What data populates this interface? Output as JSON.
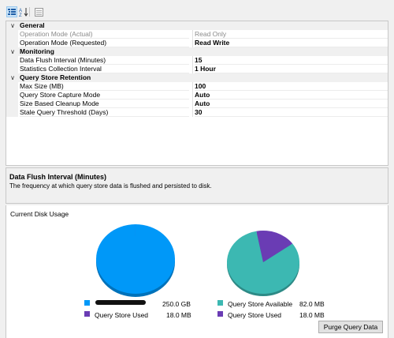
{
  "toolbar": {
    "categorized": "categorized-view-icon",
    "alphabetical": "alphabetical-sort-icon",
    "property_pages": "property-pages-icon"
  },
  "properties": {
    "general": {
      "title": "General",
      "operation_mode_actual": {
        "label": "Operation Mode (Actual)",
        "value": "Read Only"
      },
      "operation_mode_requested": {
        "label": "Operation Mode (Requested)",
        "value": "Read Write"
      }
    },
    "monitoring": {
      "title": "Monitoring",
      "data_flush_interval": {
        "label": "Data Flush Interval (Minutes)",
        "value": "15"
      },
      "statistics_collection_interval": {
        "label": "Statistics Collection Interval",
        "value": "1 Hour"
      }
    },
    "retention": {
      "title": "Query Store Retention",
      "max_size": {
        "label": "Max Size (MB)",
        "value": "100"
      },
      "capture_mode": {
        "label": "Query Store Capture Mode",
        "value": "Auto"
      },
      "cleanup_mode": {
        "label": "Size Based Cleanup Mode",
        "value": "Auto"
      },
      "stale_threshold": {
        "label": "Stale Query Threshold (Days)",
        "value": "30"
      }
    }
  },
  "description": {
    "title": "Data Flush Interval (Minutes)",
    "text": "The frequency at which query store data is flushed and persisted to disk."
  },
  "disk": {
    "title": "Current Disk Usage",
    "purge_label": "Purge Query Data",
    "colors": {
      "database": "#0098f8",
      "query_store_used": "#6a3cb4",
      "query_store_available": "#3cb8b2"
    }
  },
  "chart_data": [
    {
      "type": "pie",
      "slices": [
        {
          "name": "",
          "value": 250.0,
          "label": "250.0 GB",
          "color": "#0098f8"
        },
        {
          "name": "Query Store Used",
          "value": 0.018,
          "label": "18.0 MB",
          "color": "#6a3cb4"
        }
      ]
    },
    {
      "type": "pie",
      "slices": [
        {
          "name": "Query Store Available",
          "value": 82.0,
          "label": "82.0 MB",
          "color": "#3cb8b2"
        },
        {
          "name": "Query Store Used",
          "value": 18.0,
          "label": "18.0 MB",
          "color": "#6a3cb4"
        }
      ]
    }
  ]
}
